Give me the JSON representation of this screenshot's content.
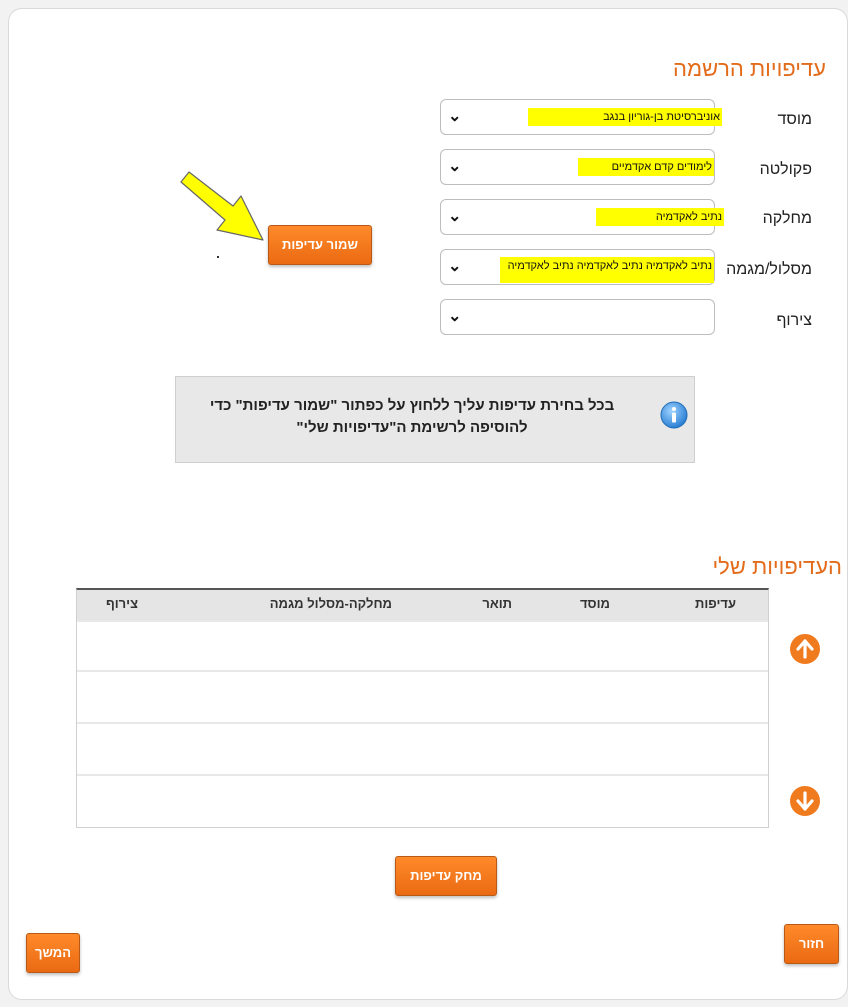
{
  "registration": {
    "title": "עדיפויות הרשמה",
    "fields": [
      {
        "label": "מוסד",
        "value": "אוניברסיטת בן-גוריון בנגב"
      },
      {
        "label": "פקולטה",
        "value": "לימודים קדם אקדמיים"
      },
      {
        "label": "מחלקה",
        "value": "נתיב לאקדמיה"
      },
      {
        "label": "מסלול/מגמה",
        "value": "נתיב לאקדמיה נתיב לאקדמיה נתיב לאקדמיה"
      },
      {
        "label": "צירוף",
        "value": ""
      }
    ],
    "save_button": "שמור עדיפות"
  },
  "info": {
    "line1": "בכל בחירת עדיפות עליך ללחוץ על כפתור \"שמור עדיפות\" כדי",
    "line2": "להוסיפה לרשימת ה\"עדיפויות שלי\""
  },
  "my_prefs": {
    "title": "העדיפויות שלי",
    "columns": [
      "עדיפות",
      "מוסד",
      "תואר",
      "מחלקה-מסלול מגמה",
      "צירוף"
    ],
    "rows": [
      [],
      [],
      [],
      []
    ]
  },
  "buttons": {
    "delete": "מחק עדיפות",
    "back": "חזור",
    "continue": "המשך"
  },
  "colors": {
    "accent": "#e36c1b",
    "button": "#f07a1e",
    "highlight": "#ffff00",
    "annotation_arrow": "#ffff00"
  }
}
